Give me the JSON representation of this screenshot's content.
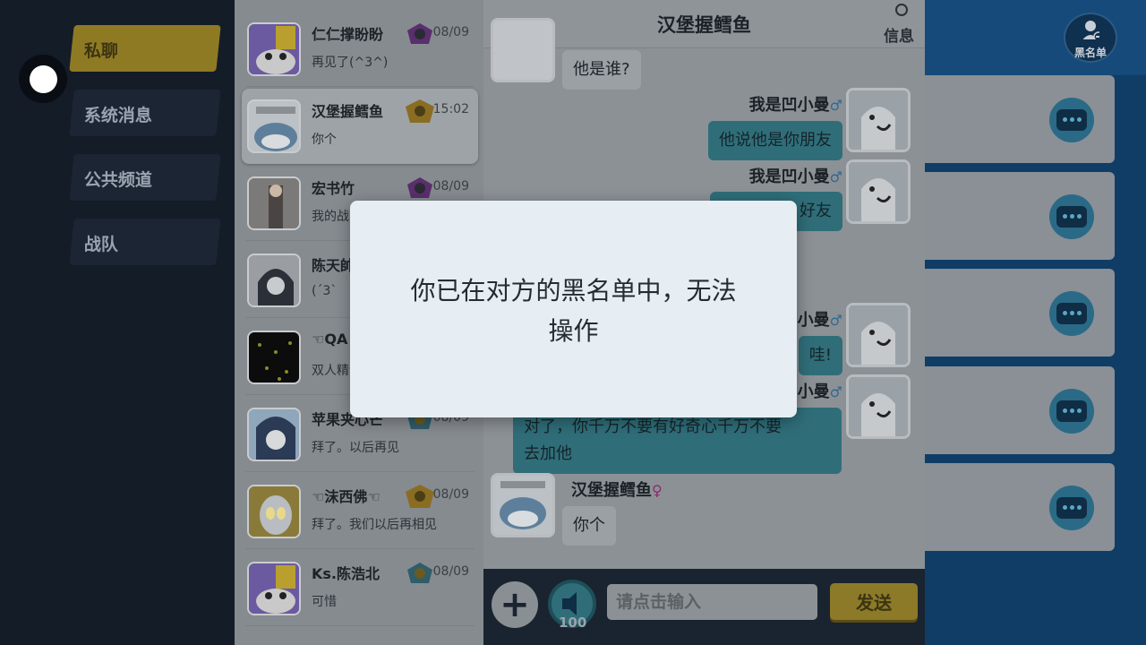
{
  "nav": {
    "categories": [
      {
        "label": "私聊",
        "active": true
      },
      {
        "label": "系统消息",
        "active": false
      },
      {
        "label": "公共频道",
        "active": false
      },
      {
        "label": "战队",
        "active": false
      }
    ]
  },
  "conversations": [
    {
      "name": "仁仁撑盼盼",
      "time": "08/09",
      "preview": "再见了(^3^)",
      "badge_icon": "purple-rank-badge-icon",
      "avatar_icon": "purple-creature-avatar"
    },
    {
      "name": "汉堡握鳕鱼",
      "time": "15:02",
      "preview": "你个",
      "badge_icon": "gold-rank-badge-icon",
      "avatar_icon": "shark-avatar",
      "selected": true
    },
    {
      "name": "宏书竹",
      "time": "08/09",
      "preview": "我的战",
      "badge_icon": "purple-rank-badge-icon",
      "avatar_icon": "character-avatar"
    },
    {
      "name": "陈天帥",
      "time": "",
      "preview": "(ˊ3ˋ",
      "badge_icon": "",
      "avatar_icon": "anime-boy-avatar"
    },
    {
      "name": "☜QA",
      "time": "",
      "preview": "双人精",
      "badge_icon": "",
      "avatar_icon": "stars-avatar"
    },
    {
      "name": "苹果夹心芒",
      "time": "08/09",
      "preview": "拜了。以后再见",
      "badge_icon": "blue-rank-badge-icon",
      "avatar_icon": "anime-girl-avatar"
    },
    {
      "name": "☜沫西佛☜",
      "time": "08/09",
      "preview": "拜了。我们以后再相见",
      "badge_icon": "gold-rank-badge-icon",
      "avatar_icon": "ultraman-avatar"
    },
    {
      "name": "Ks.陈浩北",
      "time": "08/09",
      "preview": "可惜",
      "badge_icon": "blue-rank-badge-icon",
      "avatar_icon": "purple-creature-avatar"
    }
  ],
  "chat": {
    "title": "汉堡握鳕鱼",
    "info_label": "信息",
    "messages": [
      {
        "from": "other",
        "text": "他是谁?"
      },
      {
        "from": "me",
        "sender": "我是凹小曼",
        "gender": "♂",
        "text": "他说他是你朋友"
      },
      {
        "from": "me",
        "sender": "我是凹小曼",
        "gender": "♂",
        "text": "好友"
      },
      {
        "from": "me",
        "sender": "小曼",
        "gender": "♂",
        "text": "哇!"
      },
      {
        "from": "me",
        "sender": "小曼",
        "gender": "♂",
        "text_line1": "对了，你千万不要有好奇心千万不要",
        "text_line2": "去加他"
      },
      {
        "from": "other",
        "sender": "汉堡握鳕鱼",
        "gender": "♀",
        "text": "你个"
      }
    ],
    "input_placeholder": "请点击输入",
    "send_label": "发送",
    "voice_count": "100"
  },
  "blacklist": {
    "label": "黑名单"
  },
  "modal": {
    "message_line1": "你已在对方的黑名单中，无法",
    "message_line2": "操作"
  },
  "colors": {
    "accent_gold": "#8f7a24",
    "bubble_me": "#2f6e79",
    "modal_bg": "#e6eef3"
  }
}
